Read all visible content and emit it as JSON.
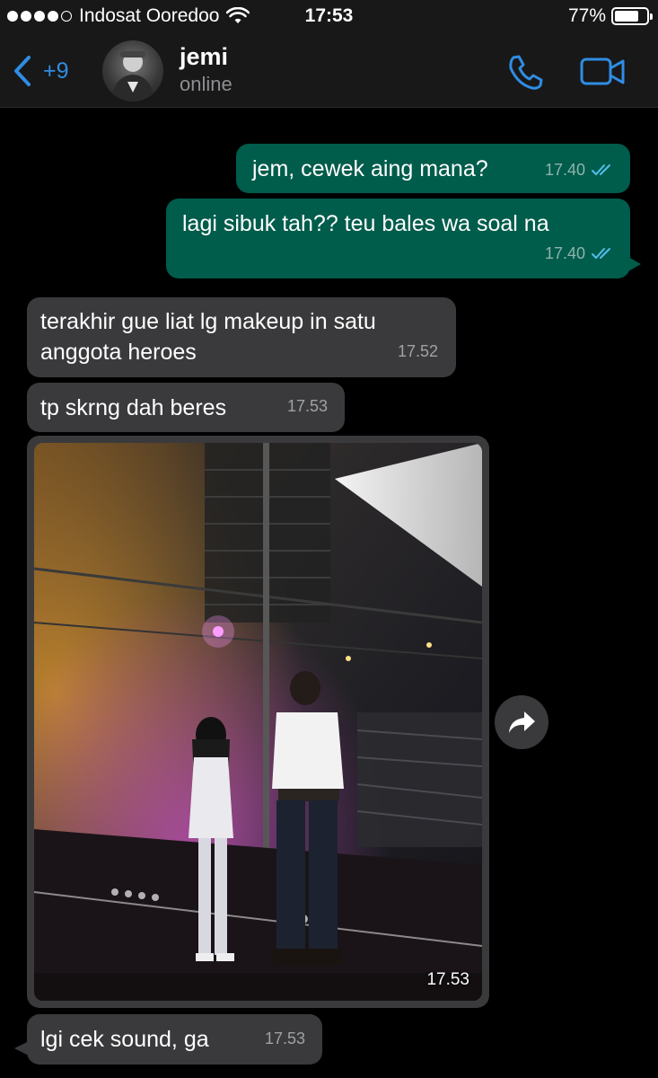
{
  "status_bar": {
    "carrier": "Indosat Ooredoo",
    "time": "17:53",
    "battery_percent": "77%",
    "battery_level": 0.77,
    "signal_bars": 4,
    "signal_max": 5,
    "icons": [
      "wifi-icon",
      "battery-icon"
    ]
  },
  "header": {
    "back_count": "+9",
    "contact_name": "jemi",
    "contact_status": "online",
    "icons": [
      "back-chevron-icon",
      "phone-icon",
      "video-camera-icon"
    ],
    "accent_color": "#2f8de4"
  },
  "messages": [
    {
      "direction": "outgoing",
      "text": "jem, cewek aing mana?",
      "time": "17.40",
      "status": "read"
    },
    {
      "direction": "outgoing",
      "text": "lagi sibuk tah?? teu bales wa soal na",
      "time": "17.40",
      "status": "read"
    },
    {
      "direction": "incoming",
      "text": "terakhir gue liat lg makeup in satu\nanggota heroes",
      "time": "17.52"
    },
    {
      "direction": "incoming",
      "text": "tp skrng dah beres",
      "time": "17.53"
    },
    {
      "direction": "incoming",
      "type": "photo",
      "time": "17.53"
    },
    {
      "direction": "incoming",
      "text": "lgi cek sound, ga",
      "time": "17.53"
    }
  ],
  "colors": {
    "outgoing_bubble": "#005c4b",
    "incoming_bubble": "#3a3a3c",
    "read_ticks": "#53bdeb",
    "background": "#000000"
  }
}
